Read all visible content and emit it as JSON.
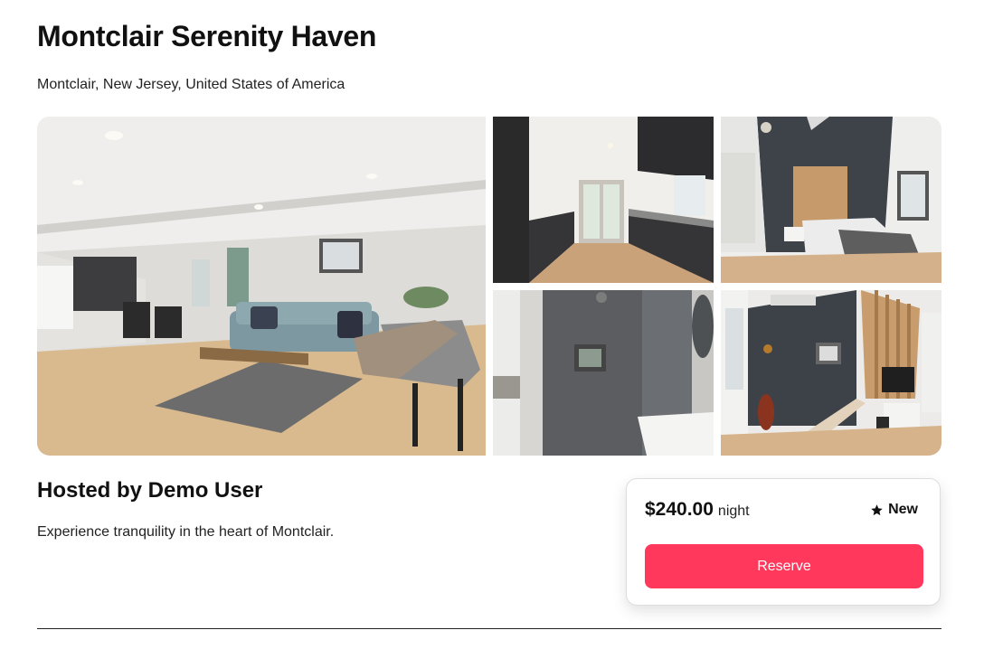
{
  "listing": {
    "title": "Montclair Serenity Haven",
    "location": "Montclair, New Jersey, United States of America",
    "host": "Hosted by Demo User",
    "description": "Experience tranquility in the heart of Montclair."
  },
  "gallery": {
    "photos": [
      {
        "subject": "living room"
      },
      {
        "subject": "kitchen"
      },
      {
        "subject": "bedroom"
      },
      {
        "subject": "bathroom"
      },
      {
        "subject": "staircase"
      }
    ]
  },
  "booking": {
    "price": "$240.00",
    "unit": "night",
    "rating_icon": "star-icon",
    "rating_label": "New",
    "reserve_label": "Reserve",
    "accent_color": "#ff385c"
  }
}
